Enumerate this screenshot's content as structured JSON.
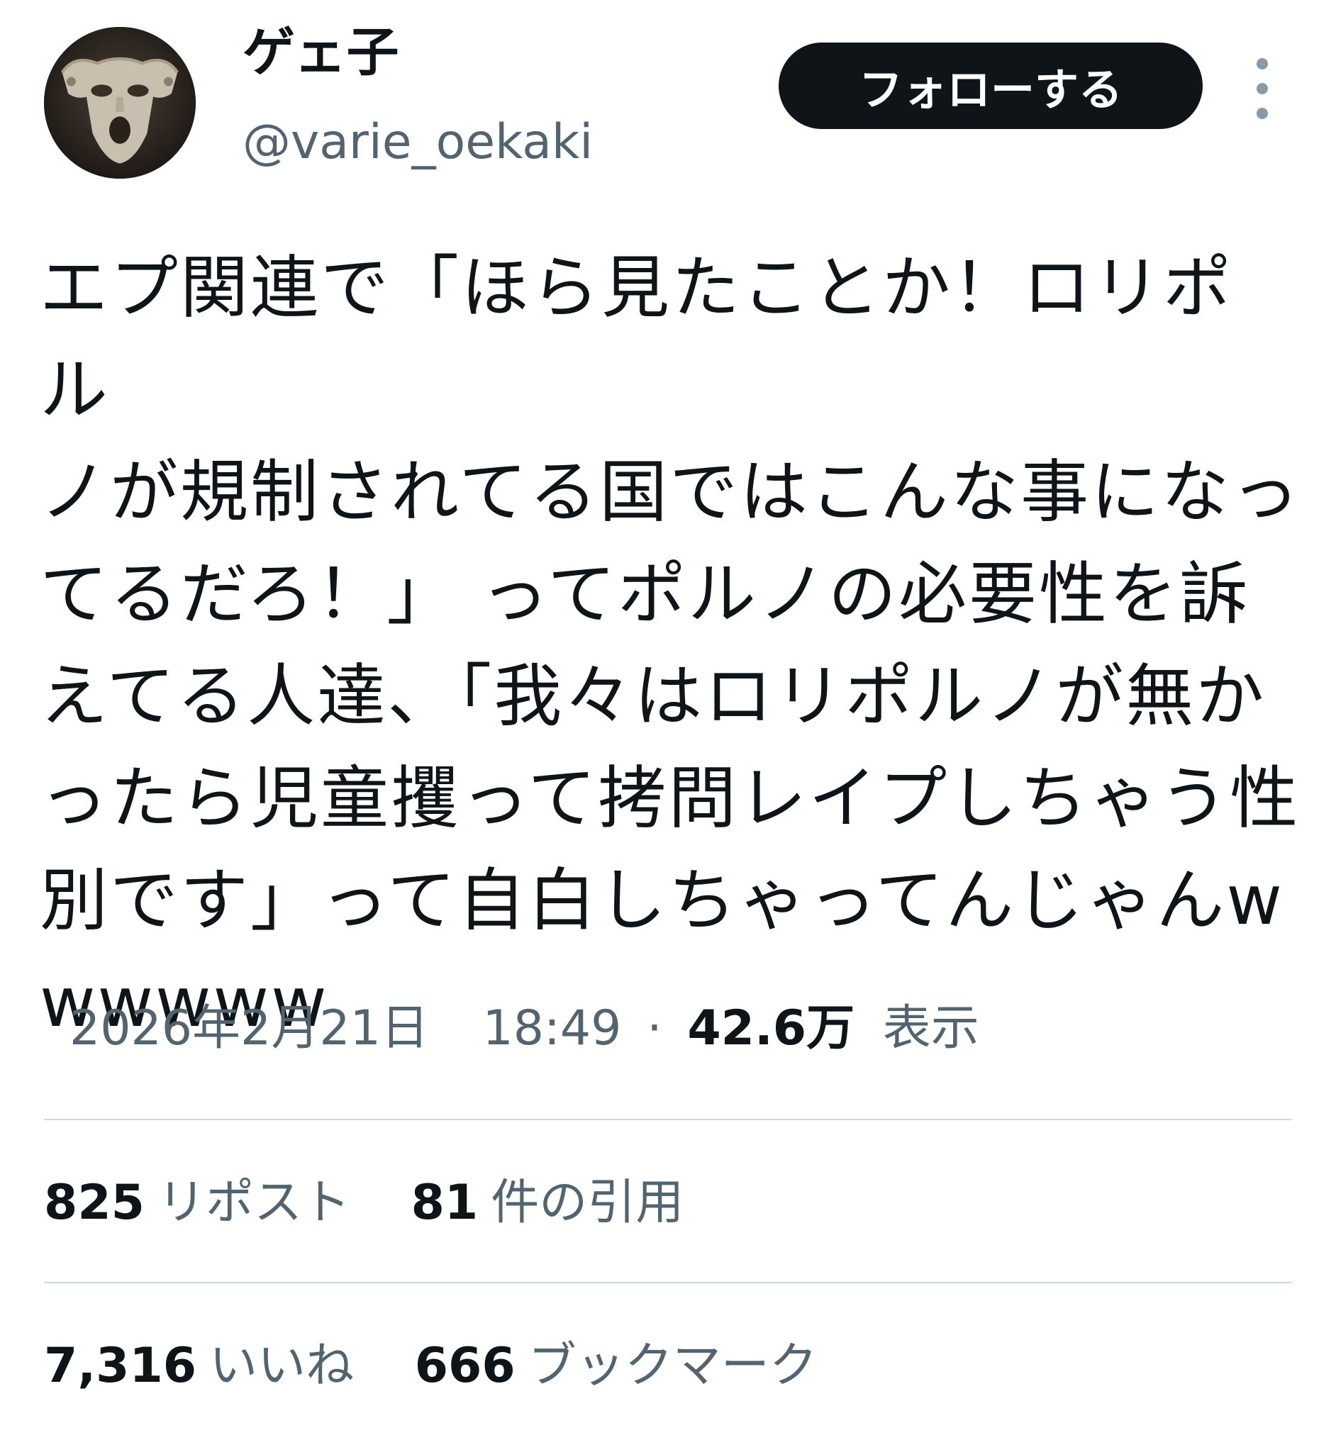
{
  "user": {
    "display_name": "ゲェ子",
    "handle": "@varie_oekaki"
  },
  "follow_button_label": "フォローする",
  "more_icon": "more-vertical-icon",
  "tweet": {
    "text": "エプ関連で「ほら見たことか！ロリポル\nノが規制されてる国ではこんな事になっ\nてるだろ！」 ってポルノの必要性を訴\nえてる人達、「我々はロリポルノが無か\nったら児童攫って拷問レイプしちゃう性\n別です」って自白しちゃってんじゃんw\nwwwww"
  },
  "meta": {
    "date": "2026年2月21日",
    "time": "18:49",
    "separator": "·",
    "views_count": "42.6万",
    "views_label": "表示"
  },
  "stats": {
    "reposts_count": "825",
    "reposts_label": "リポスト",
    "quotes_count": "81",
    "quotes_label": "件の引用",
    "likes_count": "7,316",
    "likes_label": "いいね",
    "bookmarks_count": "666",
    "bookmarks_label": "ブックマーク"
  },
  "colors": {
    "text": "#0f1419",
    "secondary": "#536471",
    "divider": "#cfd9de",
    "follow_bg": "#0f1419",
    "follow_text": "#ffffff"
  }
}
